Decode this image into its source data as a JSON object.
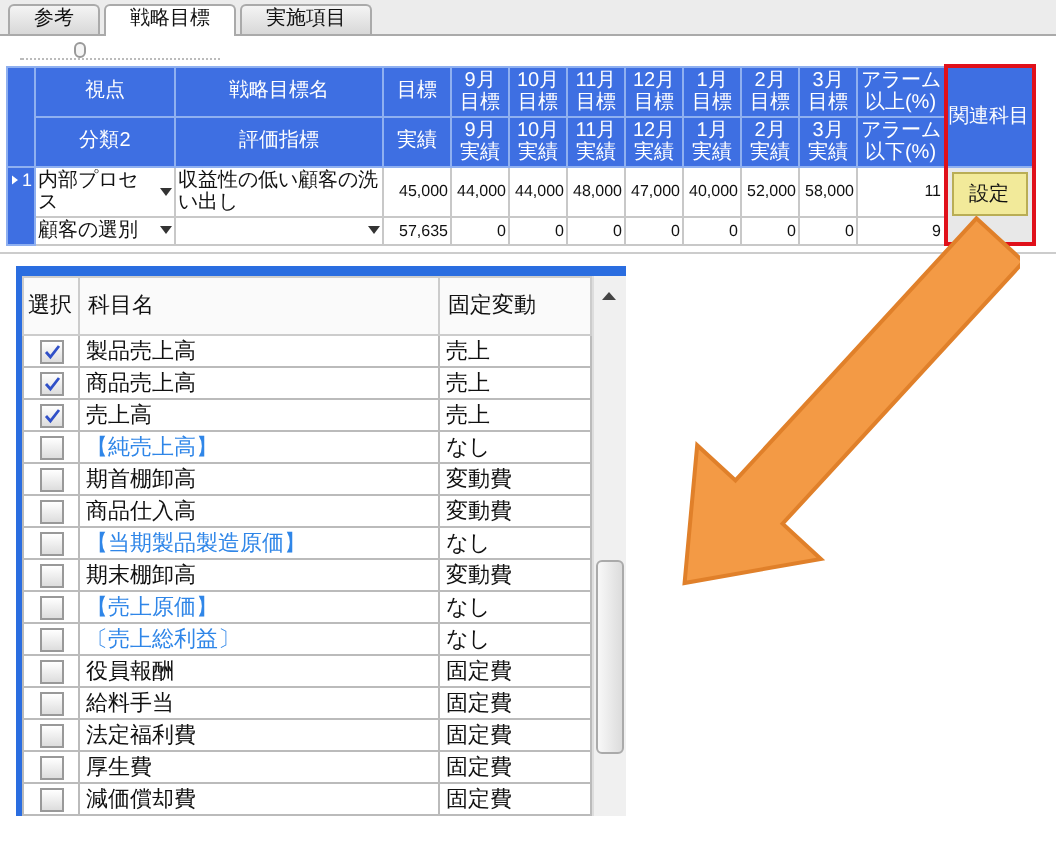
{
  "tabs": [
    {
      "label": "参考",
      "selected": false
    },
    {
      "label": "戦略目標",
      "selected": true
    },
    {
      "label": "実施項目",
      "selected": false
    }
  ],
  "slider": {
    "level": 0.3
  },
  "grid": {
    "header_top": [
      {
        "text": "視点"
      },
      {
        "text": "戦略目標名"
      },
      {
        "text": "目標"
      },
      {
        "month": "9月",
        "text": "目標"
      },
      {
        "month": "10月",
        "text": "目標"
      },
      {
        "month": "11月",
        "text": "目標"
      },
      {
        "month": "12月",
        "text": "目標"
      },
      {
        "month": "1月",
        "text": "目標"
      },
      {
        "month": "2月",
        "text": "目標"
      },
      {
        "month": "3月",
        "text": "目標"
      },
      {
        "text": "アラーム以上(%)"
      }
    ],
    "header_bottom": [
      {
        "text": "分類2"
      },
      {
        "text": "評価指標"
      },
      {
        "text": "実績"
      },
      {
        "month": "9月",
        "text": "実績"
      },
      {
        "month": "10月",
        "text": "実績"
      },
      {
        "month": "11月",
        "text": "実績"
      },
      {
        "month": "12月",
        "text": "実績"
      },
      {
        "month": "1月",
        "text": "実績"
      },
      {
        "month": "2月",
        "text": "実績"
      },
      {
        "month": "3月",
        "text": "実績"
      },
      {
        "text": "アラーム以下(%)"
      }
    ],
    "related_header": "関連科目",
    "row_header": {
      "label": "1",
      "current": true
    },
    "rows": [
      {
        "cells": [
          {
            "text": "内部プロセス",
            "dropdown": true
          },
          {
            "text": "収益性の低い顧客の洗い出し",
            "dropdown": false
          },
          {
            "text": "45,000"
          },
          {
            "text": "44,000"
          },
          {
            "text": "44,000"
          },
          {
            "text": "48,000"
          },
          {
            "text": "47,000"
          },
          {
            "text": "40,000"
          },
          {
            "text": "52,000"
          },
          {
            "text": "58,000"
          },
          {
            "text": "11"
          }
        ]
      },
      {
        "cells": [
          {
            "text": "顧客の選別",
            "dropdown": true
          },
          {
            "dropdown": true
          },
          {
            "text": "57,635"
          },
          {
            "text": "0"
          },
          {
            "text": "0"
          },
          {
            "text": "0"
          },
          {
            "text": "0"
          },
          {
            "text": "0"
          },
          {
            "text": "0"
          },
          {
            "text": "0"
          },
          {
            "text": "9"
          }
        ]
      }
    ],
    "setting_button": "設定"
  },
  "dialog": {
    "columns": [
      "選択",
      "科目名",
      "固定変動"
    ],
    "rows": [
      {
        "name": "製品売上高",
        "type": "売上",
        "checked": true,
        "kind": "account"
      },
      {
        "name": "商品売上高",
        "type": "売上",
        "checked": true,
        "kind": "account"
      },
      {
        "name": "売上高",
        "type": "売上",
        "checked": true,
        "kind": "account"
      },
      {
        "name": "【純売上高】",
        "type": "なし",
        "checked": false,
        "kind": "subtotal"
      },
      {
        "name": "期首棚卸高",
        "type": "変動費",
        "checked": false,
        "kind": "account"
      },
      {
        "name": "商品仕入高",
        "type": "変動費",
        "checked": false,
        "kind": "account"
      },
      {
        "name": "【当期製品製造原価】",
        "type": "なし",
        "checked": false,
        "kind": "subtotal"
      },
      {
        "name": "期末棚卸高",
        "type": "変動費",
        "checked": false,
        "kind": "account"
      },
      {
        "name": "【売上原価】",
        "type": "なし",
        "checked": false,
        "kind": "subtotal"
      },
      {
        "name": "〔売上総利益〕",
        "type": "なし",
        "checked": false,
        "kind": "subtotal"
      },
      {
        "name": "役員報酬",
        "type": "固定費",
        "checked": false,
        "kind": "account"
      },
      {
        "name": "給料手当",
        "type": "固定費",
        "checked": false,
        "kind": "account"
      },
      {
        "name": "法定福利費",
        "type": "固定費",
        "checked": false,
        "kind": "account"
      },
      {
        "name": "厚生費",
        "type": "固定費",
        "checked": false,
        "kind": "account"
      },
      {
        "name": "減価償却費",
        "type": "固定費",
        "checked": false,
        "kind": "account"
      }
    ]
  }
}
